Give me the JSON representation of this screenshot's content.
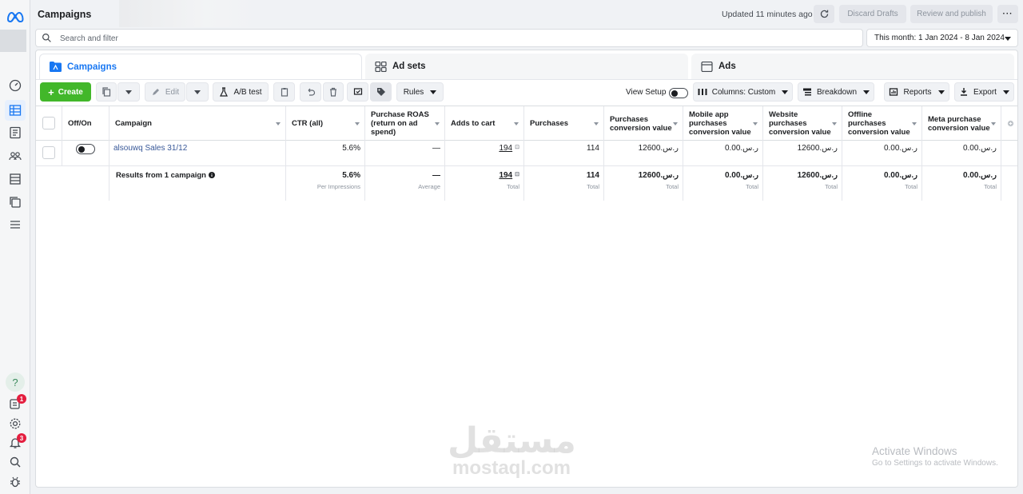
{
  "header": {
    "title": "Campaigns",
    "updated": "Updated 11 minutes ago",
    "discard_drafts": "Discard Drafts",
    "review_publish": "Review and publish",
    "more": "···"
  },
  "search": {
    "placeholder": "Search and filter",
    "date_range": "This month: 1 Jan 2024 - 8 Jan 2024"
  },
  "tabs": [
    {
      "label": "Campaigns",
      "active": true
    },
    {
      "label": "Ad sets",
      "active": false
    },
    {
      "label": "Ads",
      "active": false
    }
  ],
  "toolbar": {
    "create": "Create",
    "edit": "Edit",
    "ab_test": "A/B test",
    "rules": "Rules",
    "view_setup": "View Setup",
    "columns": "Columns: Custom",
    "breakdown": "Breakdown",
    "reports": "Reports",
    "export": "Export"
  },
  "table": {
    "columns": [
      "Off/On",
      "Campaign",
      "CTR (all)",
      "Purchase ROAS (return on ad spend)",
      "Adds to cart",
      "Purchases",
      "Purchases conversion value",
      "Mobile app purchases conversion value",
      "Website purchases conversion value",
      "Offline purchases conversion value",
      "Meta purchase conversion value"
    ],
    "rows": [
      {
        "campaign": "alsouwq Sales 31/12",
        "ctr": "5.6%",
        "roas": "—",
        "adds_to_cart": "194",
        "purchases": "114",
        "purchases_value": "ر.س.12600",
        "mobile_value": "ر.س.0.00",
        "website_value": "ر.س.12600",
        "offline_value": "ر.س.0.00",
        "meta_value": "ر.س.0.00"
      }
    ],
    "summary": {
      "label": "Results from 1 campaign",
      "ctr": "5.6%",
      "ctr_sub": "Per Impressions",
      "roas": "—",
      "roas_sub": "Average",
      "adds_to_cart": "194",
      "adds_to_cart_sub": "Total",
      "purchases": "114",
      "purchases_sub": "Total",
      "purchases_value": "ر.س.12600",
      "purchases_value_sub": "Total",
      "mobile_value": "ر.س.0.00",
      "mobile_value_sub": "Total",
      "website_value": "ر.س.12600",
      "website_value_sub": "Total",
      "offline_value": "ر.س.0.00",
      "offline_value_sub": "Total",
      "meta_value": "ر.س.0.00",
      "meta_value_sub": "Total"
    }
  },
  "rail": {
    "badges": {
      "updates": "1",
      "notifications": "3"
    },
    "help": "?"
  },
  "watermark": {
    "arabic": "مستقل",
    "latin": "mostaql.com",
    "activate_title": "Activate Windows",
    "activate_sub": "Go to Settings to activate Windows."
  },
  "colors": {
    "accent": "#1877f2",
    "create": "#42b72a",
    "badge": "#e41e3f"
  }
}
